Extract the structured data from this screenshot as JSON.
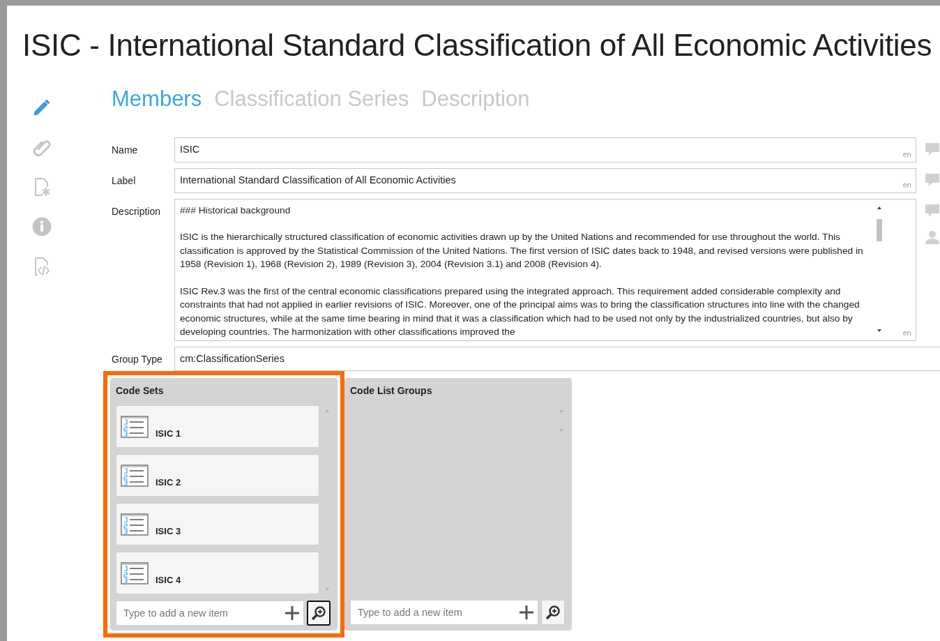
{
  "window": {
    "title": "ISIC - International Standard Classification of All Economic Activities"
  },
  "sidebar": {
    "items": [
      {
        "kind": "pencil",
        "selected": true
      },
      {
        "kind": "paperclip",
        "selected": false
      },
      {
        "kind": "document-star",
        "selected": false
      },
      {
        "kind": "info",
        "selected": false
      },
      {
        "kind": "document-code",
        "selected": false
      }
    ]
  },
  "tabs": [
    {
      "label": "Members",
      "selected": true
    },
    {
      "label": "Classification Series",
      "selected": false
    },
    {
      "label": "Description",
      "selected": false
    }
  ],
  "fields": [
    {
      "kind": "text",
      "label": "Name",
      "value": "ISIC",
      "lang": "en",
      "has_comment": true,
      "has_person": false
    },
    {
      "kind": "text",
      "label": "Label",
      "value": "International Standard Classification of All Economic Activities",
      "lang": "en",
      "has_comment": true,
      "has_person": false
    },
    {
      "kind": "multiline",
      "label": "Description",
      "paragraphs": [
        "### Historical background",
        "ISIC is the hierarchically structured classification of economic activities drawn up by the United Nations and recommended for use throughout the world. This classification is approved by the Statistical Commission of the United Nations. The first version of ISIC dates back to 1948, and revised versions were published in 1958 (Revision 1), 1968 (Revision 2), 1989 (Revision 3), 2004 (Revision 3.1) and 2008 (Revision 4).",
        "ISIC Rev.3 was the first of the central economic classifications prepared using the integrated approach. This requirement added considerable complexity and constraints that had not applied in earlier revisions of ISIC. Moreover, one of the principal aims was to bring the classification structures into line with the changed economic structures, while at the same time bearing in mind that it was a classification which had to be used not only by the industrialized countries, but also by developing countries. The harmonization with other classifications improved the"
      ],
      "lang": "en",
      "has_comment": true,
      "has_person": true
    },
    {
      "kind": "plain",
      "label": "Group Type",
      "value": "cm:ClassificationSeries",
      "has_comment": false,
      "has_person": false
    }
  ],
  "panels": [
    {
      "title": "Code Sets",
      "highlighted": true,
      "search_focused": true,
      "placeholder": "Type to add a new item",
      "items": [
        {
          "label": "ISIC 1"
        },
        {
          "label": "ISIC 2"
        },
        {
          "label": "ISIC 3"
        },
        {
          "label": "ISIC 4"
        }
      ]
    },
    {
      "title": "Code List Groups",
      "highlighted": false,
      "search_focused": false,
      "placeholder": "Type to add a new item"
    }
  ]
}
